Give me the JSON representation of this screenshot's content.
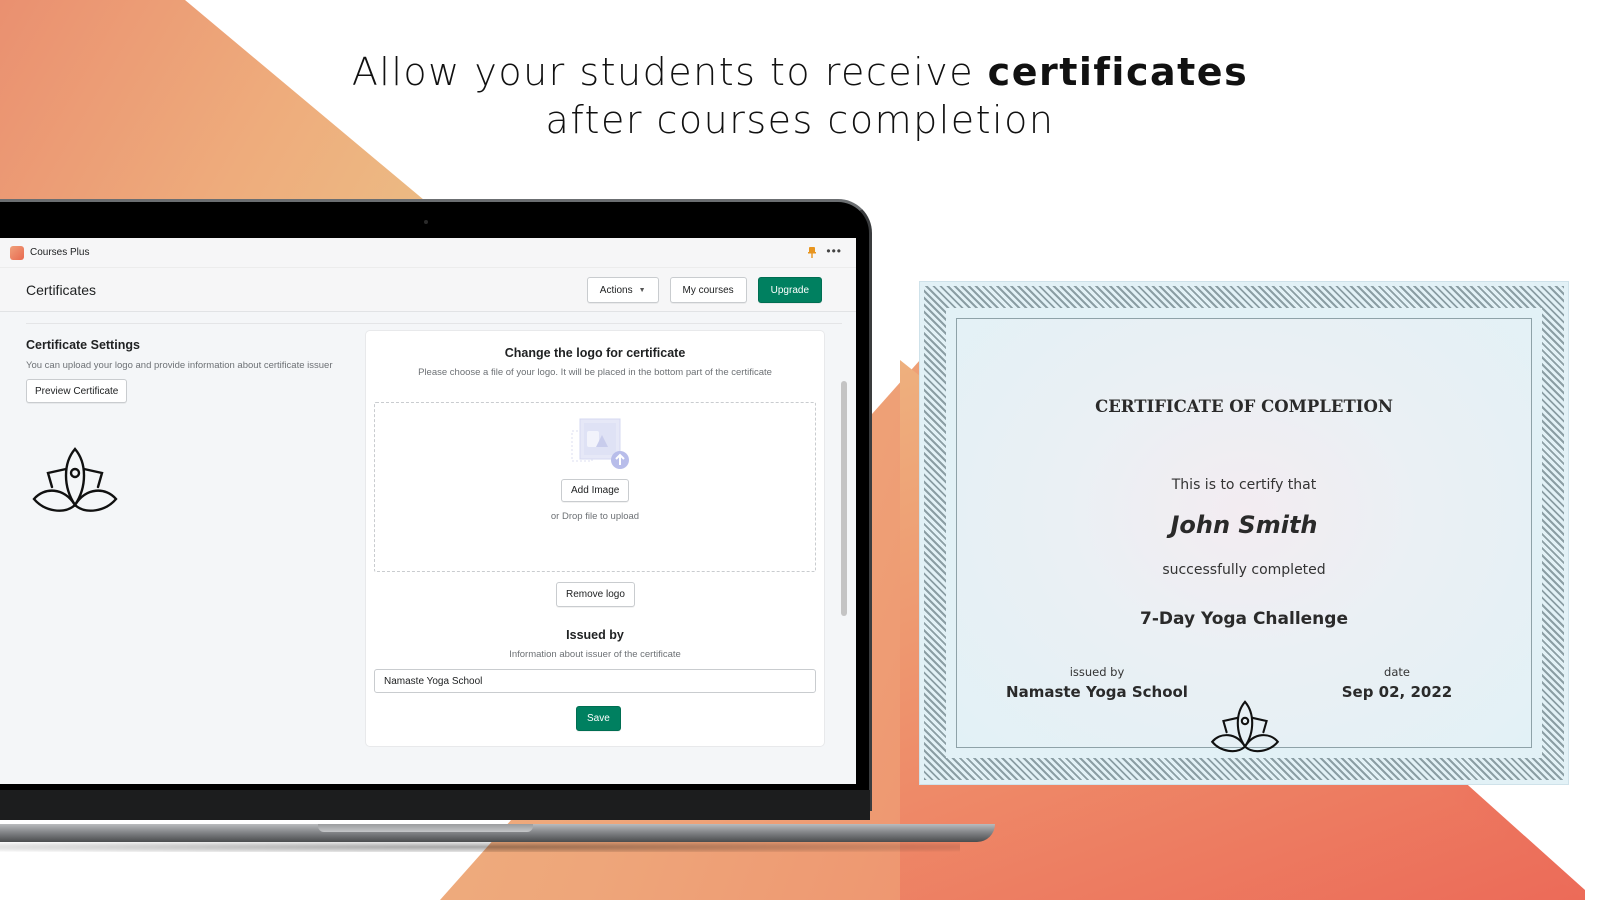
{
  "headline": {
    "line1_prefix": "Allow your students to receive ",
    "line1_bold": "certificates",
    "line2": "after courses completion"
  },
  "app": {
    "name": "Courses Plus",
    "pin_icon": "pin-icon",
    "more_icon": "more-horizontal-icon",
    "accent_color": "#008060"
  },
  "page_header": {
    "title": "Certificates",
    "actions_label": "Actions",
    "my_courses_label": "My courses",
    "upgrade_label": "Upgrade"
  },
  "settings": {
    "title": "Certificate Settings",
    "description": "You can upload your logo and provide information about certificate issuer",
    "preview_button": "Preview Certificate",
    "logo_icon": "lotus-icon"
  },
  "logo_card": {
    "title": "Change the logo for certificate",
    "subtitle": "Please choose a file of your logo. It will be placed in the bottom part of the certificate",
    "add_image_label": "Add Image",
    "drop_text": "or Drop file to upload",
    "remove_logo_label": "Remove logo",
    "issued_title": "Issued by",
    "issued_subtitle": "Information about issuer of the certificate",
    "issuer_value": "Namaste Yoga School",
    "save_label": "Save"
  },
  "certificate": {
    "title": "CERTIFICATE OF COMPLETION",
    "certify_text": "This is to certify that",
    "student_name": "John Smith",
    "completed_text": "successfully completed",
    "course_name": "7-Day Yoga Challenge",
    "issued_by_label": "issued by",
    "issued_by_value": "Namaste Yoga School",
    "date_label": "date",
    "date_value": "Sep 02, 2022"
  }
}
